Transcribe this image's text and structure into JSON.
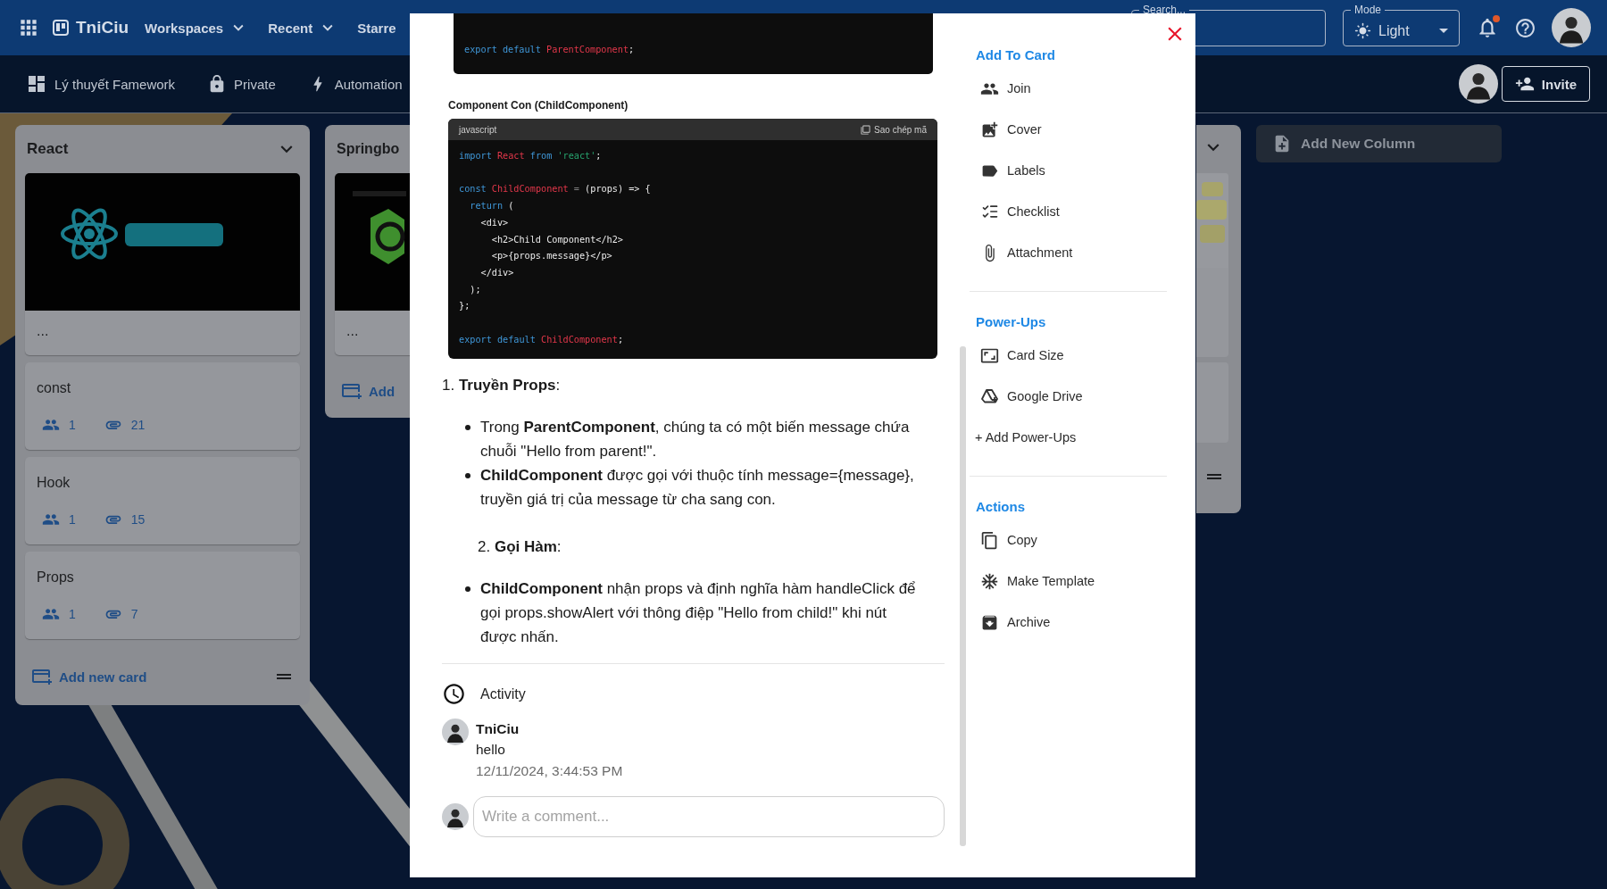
{
  "app_bar": {
    "logo": "TniCiu",
    "menus": [
      {
        "label": "Workspaces",
        "caret": true
      },
      {
        "label": "Recent",
        "caret": true
      },
      {
        "label": "Starre",
        "caret": false
      }
    ],
    "search": {
      "label": "Search..."
    },
    "mode": {
      "label": "Mode",
      "value": "Light"
    },
    "notifications": {
      "unread": true
    }
  },
  "board_bar": {
    "title": "Lý thuyết Famework",
    "visibility": "Private",
    "automation": "Automation",
    "invite": "Invite"
  },
  "columns": [
    {
      "title": "React",
      "cards": [
        {
          "kind": "cover",
          "title": "..."
        },
        {
          "kind": "plain",
          "title": "const",
          "members": "1",
          "attachments": "21"
        },
        {
          "kind": "plain",
          "title": "Hook",
          "members": "1",
          "attachments": "15"
        },
        {
          "kind": "plain",
          "title": "Props",
          "members": "1",
          "attachments": "7"
        }
      ],
      "footer": "Add new card",
      "clipped": false
    },
    {
      "title": "Springbo",
      "cards": [
        {
          "kind": "cover",
          "title": "..."
        }
      ],
      "footer": "Add",
      "clipped": true
    }
  ],
  "add_column": "Add New Column",
  "card_modal": {
    "content": [
      {
        "kind": "code_tail",
        "lines": [
          {
            "kind": "code",
            "tokens": [
              {
                "kind": "kw",
                "text": "export default "
              },
              {
                "kind": "name",
                "text": "ParentComponent"
              },
              {
                "kind": "plain",
                "text": ";"
              }
            ]
          }
        ]
      },
      {
        "kind": "caption",
        "text": "Component Con (ChildComponent)"
      },
      {
        "kind": "code",
        "language": "javascript",
        "copy": "Sao chép mã",
        "lines": [
          {
            "kind": "code",
            "tokens": [
              {
                "kind": "kw",
                "text": "import "
              },
              {
                "kind": "name",
                "text": "React "
              },
              {
                "kind": "kw",
                "text": "from "
              },
              {
                "kind": "str",
                "text": "'react'"
              },
              {
                "kind": "plain",
                "text": ";"
              }
            ]
          },
          {
            "kind": "blank"
          },
          {
            "kind": "code",
            "tokens": [
              {
                "kind": "kw",
                "text": "const "
              },
              {
                "kind": "name",
                "text": "ChildComponent "
              },
              {
                "kind": "op",
                "text": "= "
              },
              {
                "kind": "plain",
                "text": "(props) => {"
              }
            ]
          },
          {
            "kind": "code",
            "tokens": [
              {
                "kind": "kw",
                "text": "  return "
              },
              {
                "kind": "plain",
                "text": "("
              }
            ]
          },
          {
            "kind": "code",
            "tokens": [
              {
                "kind": "plain",
                "text": "    <div>"
              }
            ]
          },
          {
            "kind": "code",
            "tokens": [
              {
                "kind": "plain",
                "text": "      <h2>Child Component</h2>"
              }
            ]
          },
          {
            "kind": "code",
            "tokens": [
              {
                "kind": "plain",
                "text": "      <p>{props.message}</p>"
              }
            ]
          },
          {
            "kind": "code",
            "tokens": [
              {
                "kind": "plain",
                "text": "    </div>"
              }
            ]
          },
          {
            "kind": "code",
            "tokens": [
              {
                "kind": "plain",
                "text": "  );"
              }
            ]
          },
          {
            "kind": "code",
            "tokens": [
              {
                "kind": "plain",
                "text": "};"
              }
            ]
          },
          {
            "kind": "blank"
          },
          {
            "kind": "code",
            "tokens": [
              {
                "kind": "kw",
                "text": "export default "
              },
              {
                "kind": "name",
                "text": "ChildComponent"
              },
              {
                "kind": "plain",
                "text": ";"
              }
            ]
          }
        ]
      },
      {
        "kind": "heading",
        "text": "1. **Truyền Props**:"
      },
      {
        "kind": "bullets",
        "items": [
          "Trong **ParentComponent**, chúng ta có một biến message chứa chuỗi \"Hello from parent!\".",
          "**ChildComponent** được gọi với thuộc tính message={message}, truyền giá trị của message từ cha sang con."
        ]
      },
      {
        "kind": "subheading",
        "text": "2. **Gọi Hàm**:"
      },
      {
        "kind": "bullets",
        "items": [
          "**ChildComponent** nhận props và định nghĩa hàm handleClick để gọi props.showAlert với thông điệp \"Hello from child!\" khi nút được nhấn."
        ]
      }
    ],
    "activity": {
      "title": "Activity",
      "comments": [
        {
          "author": "TniCiu",
          "text": "hello",
          "time": "12/11/2024, 3:44:53 PM"
        }
      ],
      "input": {
        "placeholder": "Write a comment..."
      }
    },
    "sidebar": [
      {
        "heading": "Add To Card",
        "items": [
          {
            "kind": "join",
            "label": "Join"
          },
          {
            "kind": "cover",
            "label": "Cover"
          },
          {
            "kind": "labels",
            "label": "Labels"
          },
          {
            "kind": "checklist",
            "label": "Checklist"
          },
          {
            "kind": "attachment",
            "label": "Attachment"
          }
        ]
      },
      {
        "heading": "Power-Ups",
        "items": [
          {
            "kind": "card_size",
            "label": "Card Size"
          },
          {
            "kind": "drive",
            "label": "Google Drive"
          },
          {
            "kind": "text",
            "label": "+ Add Power-Ups"
          }
        ]
      },
      {
        "heading": "Actions",
        "items": [
          {
            "kind": "copy",
            "label": "Copy"
          },
          {
            "kind": "template",
            "label": "Make Template"
          },
          {
            "kind": "archive",
            "label": "Archive"
          }
        ]
      }
    ]
  }
}
